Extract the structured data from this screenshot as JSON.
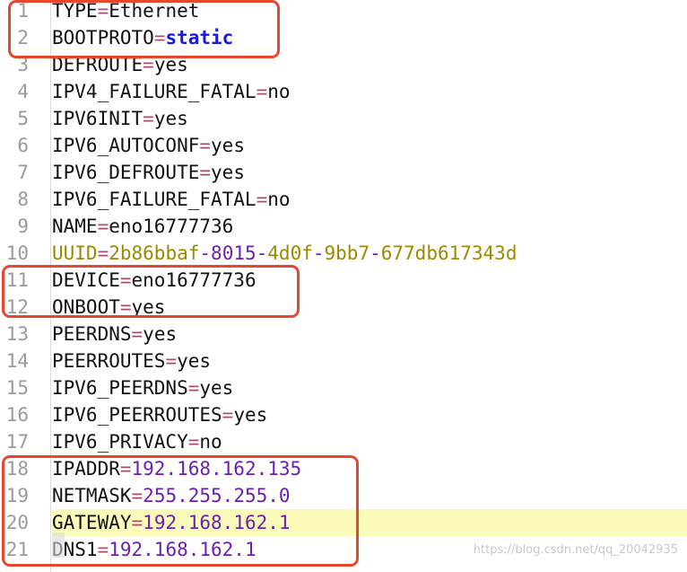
{
  "lines": [
    {
      "n": "1",
      "key": "TYPE",
      "eq": "=",
      "val": "Ethernet"
    },
    {
      "n": "2",
      "key": "BOOTPROTO",
      "eq": "=",
      "val": "static"
    },
    {
      "n": "3",
      "key": "DEFROUTE",
      "eq": "=",
      "val": "yes"
    },
    {
      "n": "4",
      "key": "IPV4_FAILURE_FATAL",
      "eq": "=",
      "val": "no"
    },
    {
      "n": "5",
      "key": "IPV6INIT",
      "eq": "=",
      "val": "yes"
    },
    {
      "n": "6",
      "key": "IPV6_AUTOCONF",
      "eq": "=",
      "val": "yes"
    },
    {
      "n": "7",
      "key": "IPV6_DEFROUTE",
      "eq": "=",
      "val": "yes"
    },
    {
      "n": "8",
      "key": "IPV6_FAILURE_FATAL",
      "eq": "=",
      "val": "no"
    },
    {
      "n": "9",
      "key": "NAME",
      "eq": "=",
      "val": "eno16777736"
    },
    {
      "n": "10",
      "key": "UUID",
      "eq": "=",
      "val": "2b86bbaf-8015-4d0f-9bb7-677db617343d"
    },
    {
      "n": "11",
      "key": "DEVICE",
      "eq": "=",
      "val": "eno16777736"
    },
    {
      "n": "12",
      "key": "ONBOOT",
      "eq": "=",
      "val": "yes"
    },
    {
      "n": "13",
      "key": "PEERDNS",
      "eq": "=",
      "val": "yes"
    },
    {
      "n": "14",
      "key": "PEERROUTES",
      "eq": "=",
      "val": "yes"
    },
    {
      "n": "15",
      "key": "IPV6_PEERDNS",
      "eq": "=",
      "val": "yes"
    },
    {
      "n": "16",
      "key": "IPV6_PEERROUTES",
      "eq": "=",
      "val": "yes"
    },
    {
      "n": "17",
      "key": "IPV6_PRIVACY",
      "eq": "=",
      "val": "no"
    },
    {
      "n": "18",
      "key": "IPADDR",
      "eq": "=",
      "val": "192.168.162.135"
    },
    {
      "n": "19",
      "key": "NETMASK",
      "eq": "=",
      "val": "255.255.255.0"
    },
    {
      "n": "20",
      "key": "GATEWAY",
      "eq": "=",
      "val": "192.168.162.1"
    },
    {
      "n": "21",
      "key": "DNS1",
      "eq": "=",
      "val": "192.168.162.1"
    }
  ],
  "highlighted_line": "20",
  "watermark": "https://blog.csdn.net/qq_20042935",
  "colors": {
    "annotation_box": "#e8462d",
    "line_highlight": "#fbfbb9",
    "equals_sign": "#a0506c",
    "keyword_value": "#1a1ad8",
    "numeric_value": "#6a1fb0",
    "uuid_text": "#9a8a00"
  }
}
